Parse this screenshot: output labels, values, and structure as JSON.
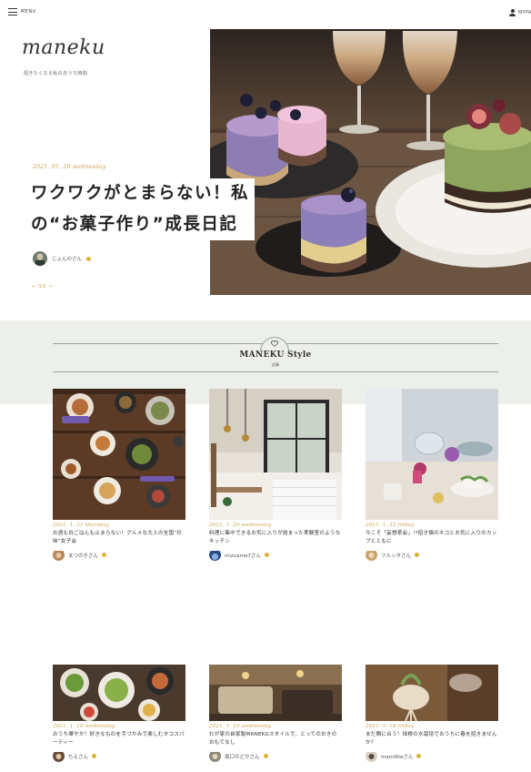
{
  "header": {
    "menu_label": "MENU",
    "mypage_label": "MYPAGE"
  },
  "brand": {
    "logo": "maneku",
    "tagline": "招きたくなる私のおうち時間"
  },
  "hero": {
    "date": "2021. 01. 20  wednesday",
    "title_line1": "ワクワクがとまらない！私",
    "title_line2": "の“お菓子作り”成長日記",
    "author": "じょんのさん",
    "pager": "3/3"
  },
  "style_section": {
    "title": "MANEKU Style",
    "subtitle": "記事"
  },
  "cards": [
    {
      "date": "2021. 1. 21  thursday",
      "title": "お酒も白ごはんも止まらない！グルメな大人の全国“珍味”女子会",
      "author": "まつのきさん"
    },
    {
      "date": "2021. 1. 20  wednesday",
      "title": "料理に集中できるお気に入りが詰まった実験室のようなキッチン",
      "author": "mizuame7さん"
    },
    {
      "date": "2021. 1. 22  friday",
      "title": "今こそ「妄想茶会」!?招き猫のネコとお気に入りのカップとともに",
      "author": "フルッタさん"
    },
    {
      "date": "2021. 1. 20  wednesday",
      "title": "おうち華やか！好きなものを手づかみで楽しむタコスパーティー",
      "author": "ちえさん"
    },
    {
      "date": "2021. 1. 20  wednesday",
      "title": "わが家の自家製MANEKUスタイルで、とってのおきのおもてなし",
      "author": "坂口のどかさん"
    },
    {
      "date": "2021. 1. 18  friday",
      "title": "まだ間に合う！球根の水栽培でおうちに春を招きませんか？",
      "author": "mamiRieさん"
    }
  ],
  "colors": {
    "accent_gold": "#c8a14a",
    "section_band": "#ecefea",
    "badge": "#e0b23c"
  }
}
